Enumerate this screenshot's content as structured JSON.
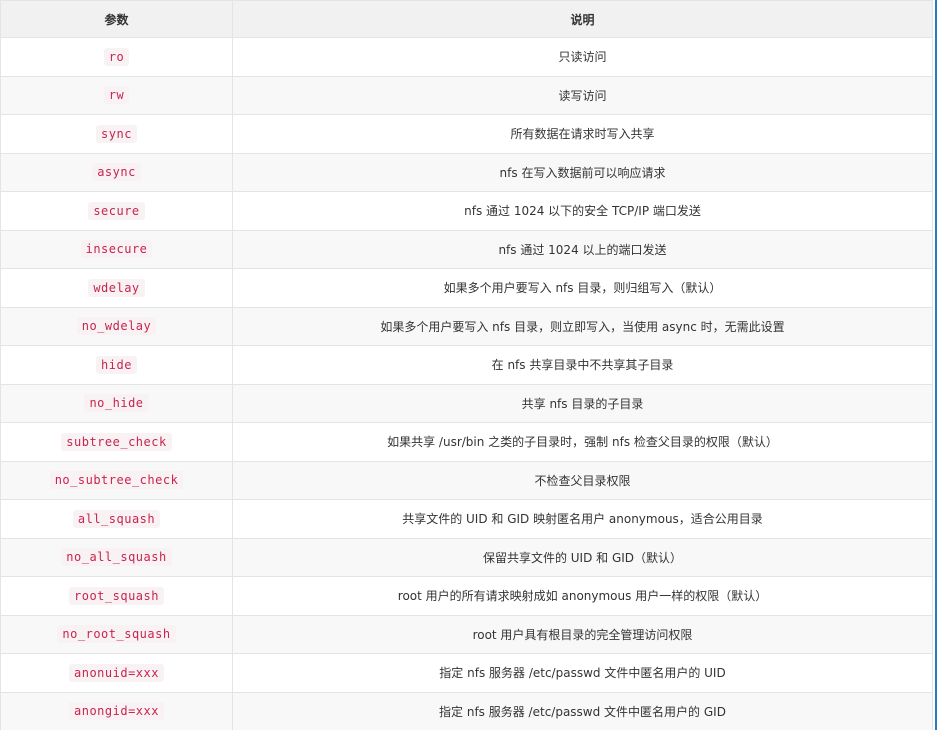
{
  "table": {
    "headers": [
      "参数",
      "说明"
    ],
    "rows": [
      {
        "param": "ro",
        "desc": "只读访问"
      },
      {
        "param": "rw",
        "desc": "读写访问"
      },
      {
        "param": "sync",
        "desc": "所有数据在请求时写入共享"
      },
      {
        "param": "async",
        "desc": "nfs 在写入数据前可以响应请求"
      },
      {
        "param": "secure",
        "desc": "nfs 通过 1024 以下的安全 TCP/IP 端口发送"
      },
      {
        "param": "insecure",
        "desc": "nfs 通过 1024 以上的端口发送"
      },
      {
        "param": "wdelay",
        "desc": "如果多个用户要写入 nfs 目录，则归组写入（默认）"
      },
      {
        "param": "no_wdelay",
        "desc": "如果多个用户要写入 nfs 目录，则立即写入，当使用 async 时，无需此设置"
      },
      {
        "param": "hide",
        "desc": "在 nfs 共享目录中不共享其子目录"
      },
      {
        "param": "no_hide",
        "desc": "共享 nfs 目录的子目录"
      },
      {
        "param": "subtree_check",
        "desc": "如果共享 /usr/bin 之类的子目录时，强制 nfs 检查父目录的权限（默认）"
      },
      {
        "param": "no_subtree_check",
        "desc": "不检查父目录权限"
      },
      {
        "param": "all_squash",
        "desc": "共享文件的 UID 和 GID 映射匿名用户 anonymous，适合公用目录"
      },
      {
        "param": "no_all_squash",
        "desc": "保留共享文件的 UID 和 GID（默认）"
      },
      {
        "param": "root_squash",
        "desc": "root 用户的所有请求映射成如 anonymous 用户一样的权限（默认）"
      },
      {
        "param": "no_root_squash",
        "desc": "root 用户具有根目录的完全管理访问权限"
      },
      {
        "param": "anonuid=xxx",
        "desc": "指定 nfs 服务器 /etc/passwd 文件中匿名用户的 UID"
      },
      {
        "param": "anongid=xxx",
        "desc": "指定 nfs 服务器 /etc/passwd 文件中匿名用户的 GID"
      }
    ]
  },
  "colors": {
    "code_text": "#c7254e",
    "code_bg": "#f9f2f4",
    "header_bg": "#f1f1f1",
    "stripe_bg": "#f8f8f8",
    "border": "#e4e4e4",
    "edge_accent": "#2a7bbd"
  }
}
